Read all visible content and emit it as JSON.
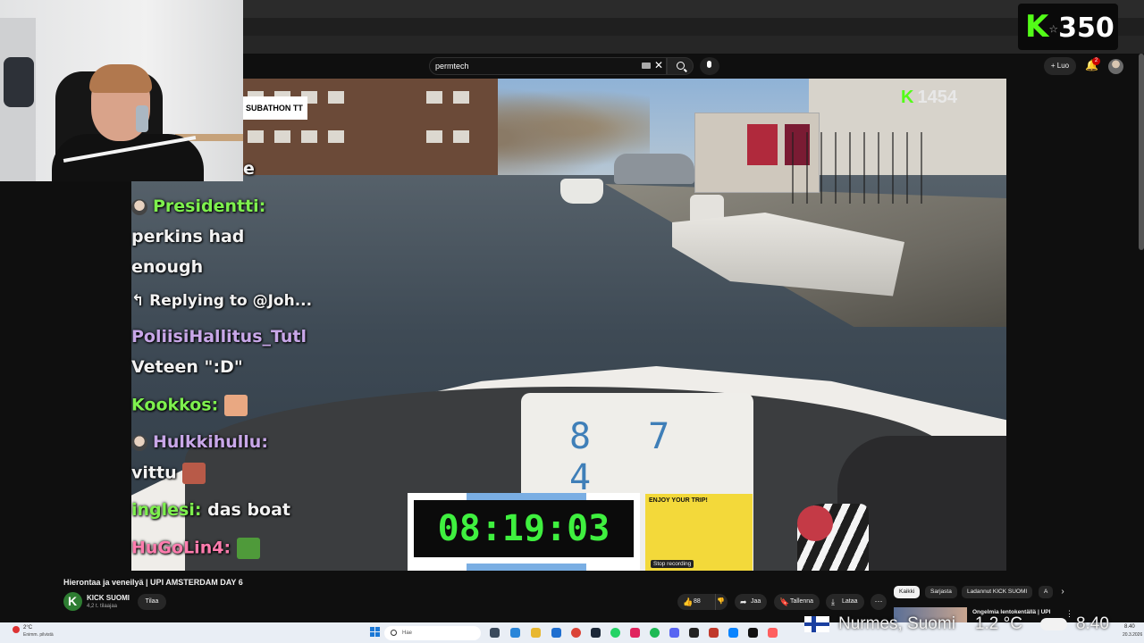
{
  "search": {
    "value": "permtech"
  },
  "header": {
    "create_label": "Luo",
    "notifications_count": "2"
  },
  "overlay": {
    "subathon_label": "SUBATHON TT",
    "kick_viewers_small": "1454",
    "kick_viewers_big": "350",
    "timer": "08:19:03",
    "boat_number": "8 7 4",
    "card_text": "ENJOY YOUR TRIP!",
    "stop_recording": "Stop recording",
    "chat_fragment": "e"
  },
  "chat": [
    {
      "user": "Presidentti:",
      "text": ""
    },
    {
      "user": "",
      "text": "perkins had"
    },
    {
      "user": "",
      "text": "enough"
    },
    {
      "user": "Replying to @Joh...",
      "text": ""
    },
    {
      "user": "PoliisiHallitus_Tutl",
      "text": ""
    },
    {
      "user": "",
      "text": "Veteen \":D\""
    },
    {
      "user": "Kookkos:",
      "text": ""
    },
    {
      "user": "Hulkkihullu:",
      "text": ""
    },
    {
      "user": "",
      "text": "vittu"
    },
    {
      "user": "inglesi:",
      "text": "das boat"
    },
    {
      "user": "HuGoLin4:",
      "text": ""
    }
  ],
  "video": {
    "title": "Hierontaa ja veneilyä | UPI AMSTERDAM DAY 6",
    "channel": "KICK SUOMI",
    "subscribers": "4,2 t. tilaajaa",
    "subscribe_label": "Tilaa",
    "likes": "88",
    "share_label": "Jaa",
    "save_label": "Tallenna",
    "download_label": "Lataa"
  },
  "chips": [
    "Kaikki",
    "Sarjasta",
    "Ladannut KICK SUOMI",
    "A"
  ],
  "recommended": {
    "title": "Ongelmia lentokentällä | UPI"
  },
  "weather_overlay": {
    "location": "Nurmes, Suomi",
    "temp": "1.2 °C",
    "time": "8.40"
  },
  "taskbar": {
    "weather_temp": "2°C",
    "weather_desc": "Enimm. pilvistä",
    "search_placeholder": "Hae",
    "clock": "8.40",
    "date": "20.3.2026"
  },
  "colors": {
    "kick_green": "#53fc18",
    "timer_green": "#3ff03f",
    "yt_bg": "#0f0f0f"
  }
}
